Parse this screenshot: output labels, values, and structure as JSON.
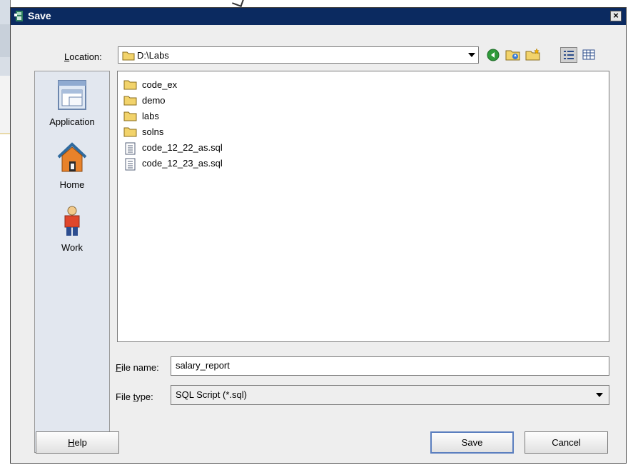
{
  "dialog": {
    "title": "Save",
    "close_label": "×"
  },
  "location": {
    "label_prefix": "L",
    "label_rest": "ocation:",
    "value": "D:\\Labs"
  },
  "toolbar": {
    "icons": [
      "back-icon",
      "up-folder-icon",
      "new-folder-icon",
      "list-view-icon",
      "details-view-icon"
    ]
  },
  "places": [
    {
      "label": "Application",
      "icon": "application-icon"
    },
    {
      "label": "Home",
      "icon": "home-icon"
    },
    {
      "label": "Work",
      "icon": "person-icon"
    }
  ],
  "files": [
    {
      "name": "code_ex",
      "type": "folder"
    },
    {
      "name": "demo",
      "type": "folder"
    },
    {
      "name": "labs",
      "type": "folder"
    },
    {
      "name": "solns",
      "type": "folder"
    },
    {
      "name": "code_12_22_as.sql",
      "type": "file"
    },
    {
      "name": "code_12_23_as.sql",
      "type": "file"
    }
  ],
  "file_name": {
    "label_prefix": "F",
    "label_rest": "ile name:",
    "value": "salary_report"
  },
  "file_type": {
    "label_prefix": "File ",
    "label_mn": "t",
    "label_rest": "ype:",
    "value": "SQL Script (*.sql)"
  },
  "buttons": {
    "help_prefix": "H",
    "help_rest": "elp",
    "save": "Save",
    "cancel": "Cancel"
  },
  "colors": {
    "titlebar": "#0b2a60",
    "dialog_bg": "#eeeeee",
    "places_bg": "#e2e7ef",
    "folder": "#f2d36b"
  }
}
